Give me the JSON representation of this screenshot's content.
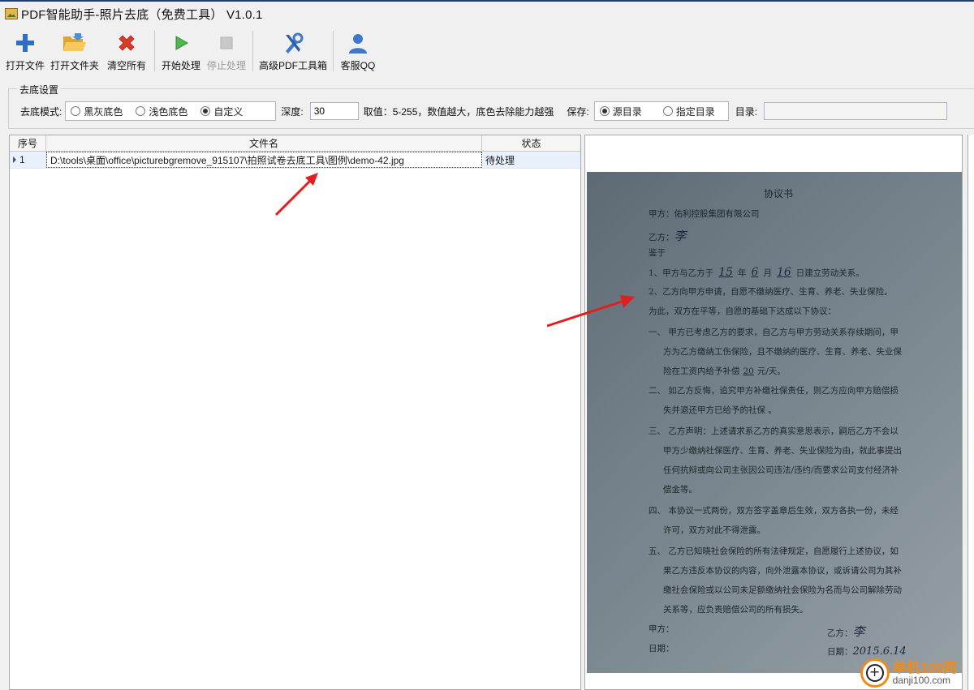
{
  "window": {
    "title": "PDF智能助手-照片去底（免费工具） V1.0.1"
  },
  "toolbar": {
    "buttons": [
      {
        "label": "打开文件",
        "icon": "plus-icon"
      },
      {
        "label": "打开文件夹",
        "icon": "folder-open-icon"
      },
      {
        "label": "清空所有",
        "icon": "red-x-icon"
      },
      {
        "label": "开始处理",
        "icon": "play-icon"
      },
      {
        "label": "停止处理",
        "icon": "stop-icon",
        "disabled": true
      },
      {
        "label": "高级PDF工具箱",
        "icon": "tools-icon"
      },
      {
        "label": "客服QQ",
        "icon": "user-icon"
      }
    ]
  },
  "settings": {
    "legend": "去底设置",
    "mode_label": "去底模式:",
    "modes": [
      {
        "label": "黑灰底色",
        "checked": false
      },
      {
        "label": "浅色底色",
        "checked": false
      },
      {
        "label": "自定义",
        "checked": true
      }
    ],
    "depth_label": "深度:",
    "depth_value": "30",
    "hint": "取值：5-255，数值越大，底色去除能力越强",
    "save_label": "保存:",
    "save_options": [
      {
        "label": "源目录",
        "checked": true
      },
      {
        "label": "指定目录",
        "checked": false
      }
    ],
    "dir_label": "目录:",
    "dir_value": ""
  },
  "file_grid": {
    "headers": {
      "index": "序号",
      "filename": "文件名",
      "status": "状态"
    },
    "rows": [
      {
        "index": "1",
        "filename": "D:\\tools\\桌面\\office\\picturebgremove_915107\\拍照试卷去底工具\\图例\\demo-42.jpg",
        "status": "待处理"
      }
    ]
  },
  "preview": {
    "doc_title": "协议书",
    "lines": [
      "甲方：佑利控股集团有限公司",
      "乙方：",
      "鉴于",
      "1、甲方与乙方于",
      "2、乙方向甲方申请，自愿不缴纳医疗、生育、养老、失业保险。",
      "为此，双方在平等，自愿的基础下达成以下协议：",
      "一、    甲方已考虑乙方的要求，自乙方与甲方劳动关系存续期间，甲",
      "方为乙方缴纳工伤保险，且不缴纳的医疗、生育、养老、失业保",
      "险在工资内给予补偿",
      "二、    如乙方反悔，追究甲方补缴社保责任，则乙方应向甲方赔偿损",
      "失并退还甲方已给予的社保 。",
      "三、    乙方声明：上述请求系乙方的真实意思表示，嗣后乙方不会以",
      "甲方少缴纳社保医疗、生育、养老、失业保险为由，就此事提出",
      "任何抗辩或向公司主张因公司违法/违约/而要求公司支付经济补",
      "偿金等。",
      "四、    本协议一式两份，双方签字盖章后生效，双方各执一份，未经",
      "许可，双方对此不得泄露。",
      "五、    乙方已知晓社会保险的所有法律规定，自愿履行上述协议，如",
      "果乙方违反本协议的内容，向外泄露本协议，或诉请公司为其补",
      "缴社会保险或以公司未足额缴纳社会保险为名而与公司解除劳动",
      "关系等，应负责赔偿公司的所有损失。",
      "甲方：",
      "日期：",
      "乙方：",
      "日期："
    ],
    "date_fill": {
      "year": "15",
      "month": "6",
      "day": "16",
      "suffix": "日建立劳动关系。",
      "y": "年",
      "m": "月"
    },
    "pay_amount": "20",
    "pay_unit": "元/天。",
    "sig_char": "李",
    "sig_date": "2015.6.14"
  },
  "watermark": {
    "brand_cn": "单机100网",
    "brand_en": "danji100.com"
  },
  "colors": {
    "arrow": "#e02020",
    "brand_orange": "#f08a1c",
    "row_selected": "#e8f1fb"
  }
}
